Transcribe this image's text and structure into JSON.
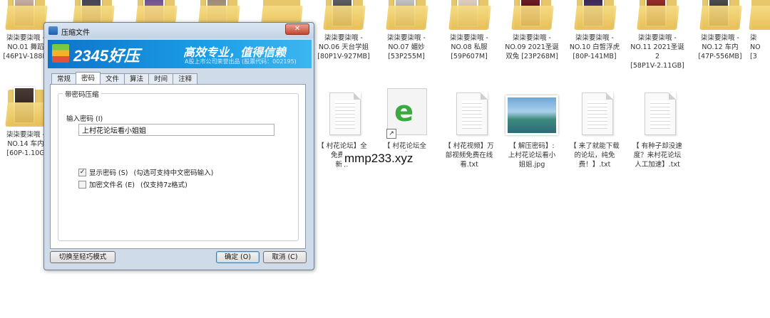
{
  "explorer": {
    "row1": [
      {
        "label": "NO.01 舞蹈\n[46P1V-188M",
        "line0": "柒柒要柒哦 -"
      },
      {
        "label": "",
        "line0": ""
      },
      {
        "label": "",
        "line0": ""
      },
      {
        "label": "",
        "line0": ""
      },
      {
        "label": "NO.06 天台学姐\n[80P1V-927MB]",
        "line0": "柒柒要柒哦 -"
      },
      {
        "label": "NO.07 媚妙\n[53P255M]",
        "line0": "柒柒要柒哦 -"
      },
      {
        "label": "NO.08 私服\n[59P607M]",
        "line0": "柒柒要柒哦 -"
      },
      {
        "label": "NO.09 2021圣诞\n双兔 [23P268M]",
        "line0": "柒柒要柒哦 -"
      },
      {
        "label": "NO.10 白皙浮虎\n[80P-141MB]",
        "line0": "柒柒要柒哦 -"
      },
      {
        "label": "NO.11 2021圣诞\n2\n[58P1V-2.11GB]",
        "line0": "柒柒要柒哦 -"
      },
      {
        "label": "NO.12 车内\n[47P-556MB]",
        "line0": "柒柒要柒哦 -"
      },
      {
        "label": "NO\n[3",
        "line0": "柒"
      }
    ],
    "row2": [
      {
        "label": "NO.14 车内\n[60P-1.10G",
        "line0": "柒柒要柒哦 -"
      },
      {
        "label": "【 村花论坛】全\n免费-无\n新节",
        "line0": ""
      },
      {
        "label": "【 村花论坛全\n文】",
        "line0": ""
      },
      {
        "label": "【 村花视频】万\n部视频免费在线\n看.txt",
        "line0": ""
      },
      {
        "label": "【 解压密码】:\n上村花论坛看小\n姐姐.jpg",
        "line0": ""
      },
      {
        "label": "【 来了就能下载\n的论坛，纯免\n费！】.txt",
        "line0": ""
      },
      {
        "label": "【 有种子却没速\n度？来村花论坛\n人工加速】.txt",
        "line0": ""
      }
    ],
    "watermark": "mmp233.xyz"
  },
  "dialog": {
    "title": "压缩文件",
    "close_label": "✕",
    "banner": {
      "logo": "2345好压",
      "slogan": "高效专业，值得信赖",
      "sub": "A股上市公司荣誉出品 (股票代码：002195)"
    },
    "tabs": [
      "常规",
      "密码",
      "文件",
      "算法",
      "时间",
      "注释"
    ],
    "active_tab": "密码",
    "group_title": "带密码压缩",
    "password_label": "输入密码 (I)",
    "password_value": "上村花论坛看小姐姐",
    "show_password_label": "显示密码 (S)",
    "show_password_hint": "(勾选可支持中文密码输入)",
    "show_password_checked": true,
    "encrypt_names_label": "加密文件名 (E)",
    "encrypt_names_hint": "(仅支持7z格式)",
    "encrypt_names_checked": false,
    "switch_mode_label": "切换至轻巧模式",
    "ok_label": "确定 (O)",
    "cancel_label": "取消 (C)"
  }
}
